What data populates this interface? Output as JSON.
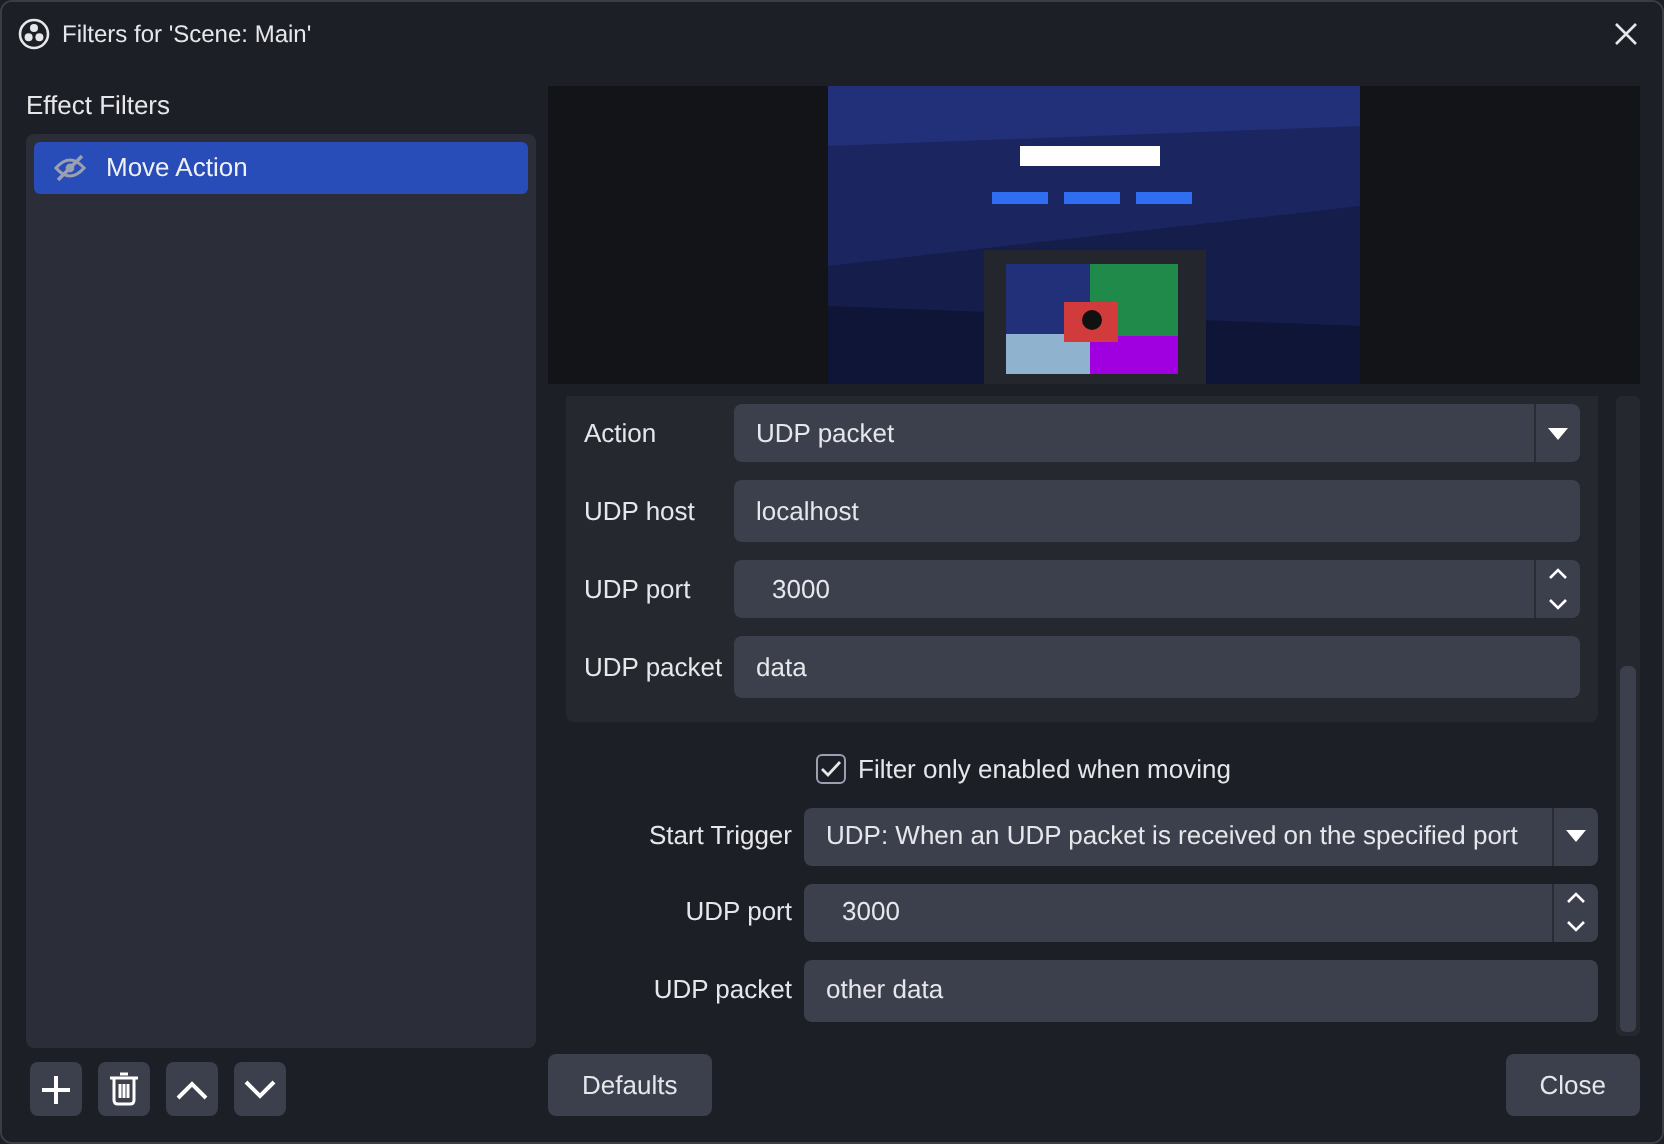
{
  "window": {
    "title": "Filters for 'Scene: Main'"
  },
  "sidebar": {
    "title": "Effect Filters",
    "filters": [
      {
        "label": "Move Action",
        "selected": true,
        "visible": false
      }
    ]
  },
  "action_group": {
    "fields": [
      {
        "kind": "dropdown",
        "label": "Action",
        "value": "UDP packet"
      },
      {
        "kind": "text",
        "label": "UDP host",
        "value": "localhost"
      },
      {
        "kind": "spin",
        "label": "UDP port",
        "value": "3000"
      },
      {
        "kind": "text",
        "label": "UDP packet",
        "value": "data"
      }
    ]
  },
  "moving_only": {
    "label": "Filter only enabled when moving",
    "checked": true
  },
  "trigger_fields": [
    {
      "kind": "dropdown",
      "label": "Start Trigger",
      "value": "UDP: When an UDP packet is received on the specified port"
    },
    {
      "kind": "spin",
      "label": "UDP port",
      "value": "3000"
    },
    {
      "kind": "text",
      "label": "UDP packet",
      "value": "other data"
    }
  ],
  "buttons": {
    "defaults": "Defaults",
    "close": "Close"
  }
}
